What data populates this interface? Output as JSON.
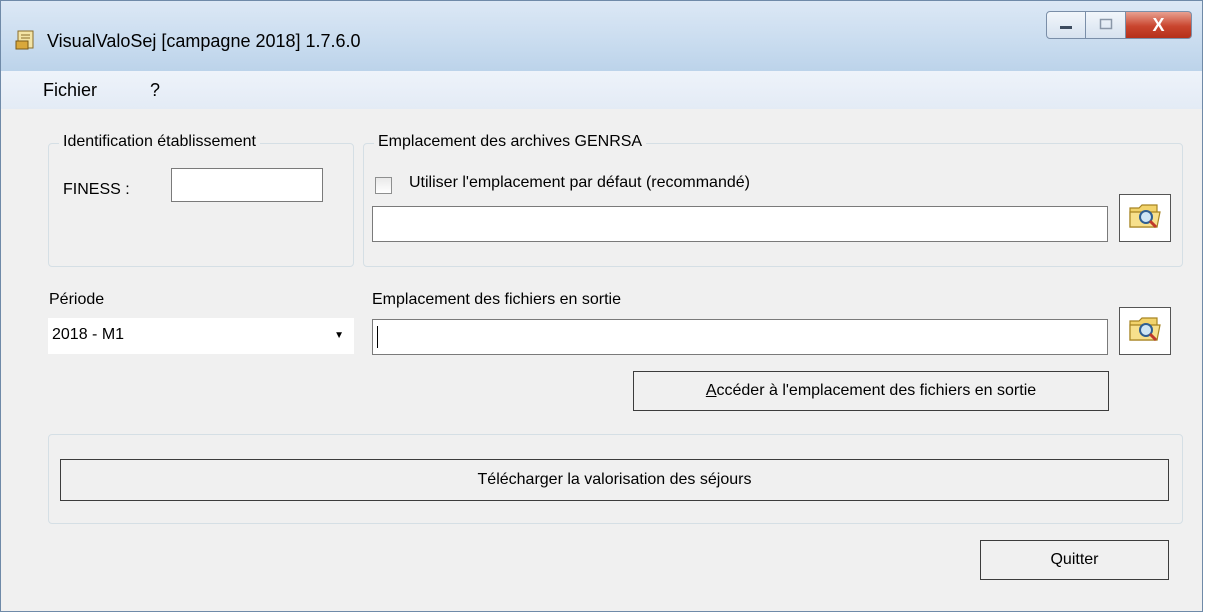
{
  "window": {
    "title": "VisualValoSej [campagne 2018] 1.7.6.0",
    "controls": {
      "minimize": "—",
      "maximize": "□",
      "close": "X"
    }
  },
  "menu": {
    "items": [
      "Fichier",
      "?"
    ]
  },
  "identification": {
    "legend": "Identification établissement",
    "finess_label": "FINESS :",
    "finess_value": ""
  },
  "archives": {
    "legend": "Emplacement des archives GENRSA",
    "checkbox_label": "Utiliser l'emplacement par défaut (recommandé)",
    "checkbox_checked": false,
    "path_value": ""
  },
  "periode": {
    "label": "Période",
    "selected": "2018 - M1"
  },
  "sortie": {
    "label": "Emplacement des fichiers en sortie",
    "path_value": "",
    "open_button_prefix": "A",
    "open_button_rest": "ccéder à l'emplacement des fichiers en sortie"
  },
  "actions": {
    "download_label": "Télécharger la valorisation des séjours",
    "quit_label": "Quitter"
  },
  "icons": {
    "app": "app-icon",
    "browse": "folder-search-icon",
    "dropdown": "chevron-down-icon"
  }
}
